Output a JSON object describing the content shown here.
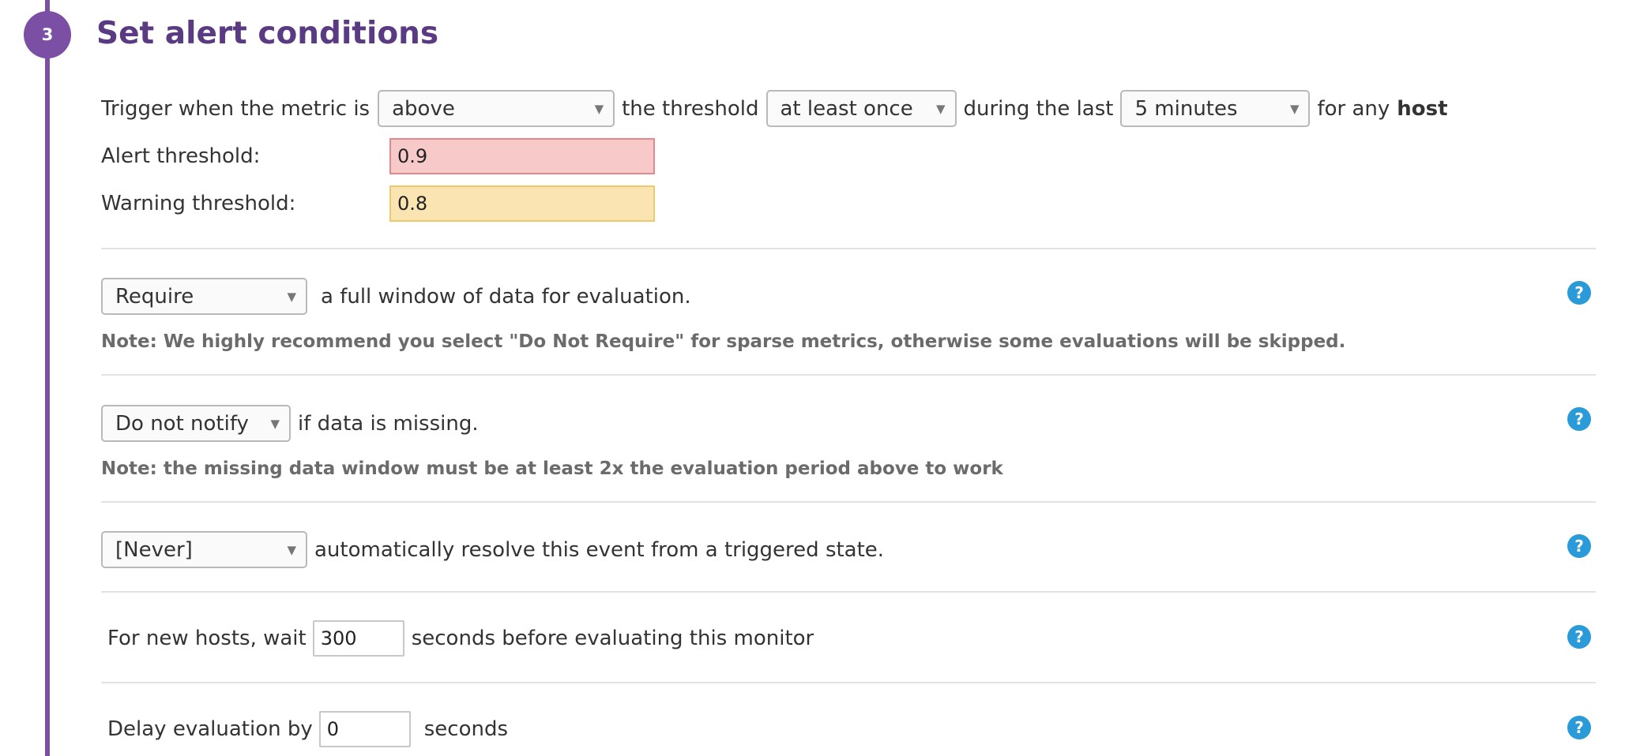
{
  "step": {
    "number": "3",
    "title": "Set alert conditions"
  },
  "trigger": {
    "prefix": "Trigger when the metric is",
    "comparison": "above",
    "mid": "the threshold",
    "frequency": "at least once",
    "during": "during the last",
    "window": "5 minutes",
    "suffix_pre": "for any",
    "suffix_bold": "host"
  },
  "thresholds": {
    "alert_label": "Alert threshold:",
    "alert_value": "0.9",
    "warning_label": "Warning threshold:",
    "warning_value": "0.8"
  },
  "full_window": {
    "select": "Require",
    "text": "a full window of data for evaluation.",
    "note": "Note: We highly recommend you select \"Do Not Require\" for sparse metrics, otherwise some evaluations will be skipped."
  },
  "missing_data": {
    "select": "Do not notify",
    "text": "if data is missing.",
    "note": "Note: the missing data window must be at least 2x the evaluation period above to work"
  },
  "auto_resolve": {
    "select": "[Never]",
    "text": "automatically resolve this event from a triggered state."
  },
  "new_hosts": {
    "prefix": "For new hosts, wait",
    "value": "300",
    "suffix": "seconds before evaluating this monitor"
  },
  "delay": {
    "prefix": "Delay evaluation by",
    "value": "0",
    "suffix": "seconds"
  },
  "icons": {
    "help": "question-mark-icon",
    "dropdown": "caret-down-icon"
  },
  "colors": {
    "accent": "#7b4fa3",
    "title": "#5a3a82",
    "alert_bg": "#f8c9c9",
    "warning_bg": "#fae4b2",
    "help": "#2a9ad8"
  }
}
